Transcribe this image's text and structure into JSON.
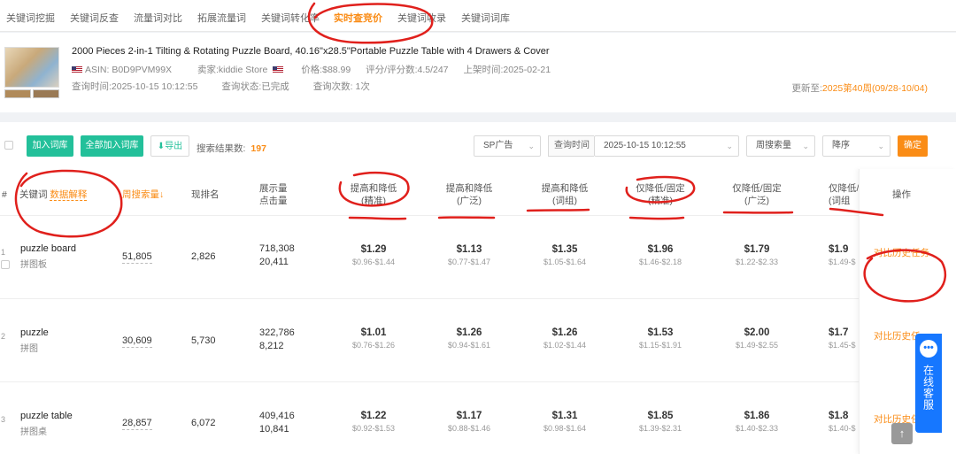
{
  "tabs": [
    "关键词挖掘",
    "关键词反查",
    "流量词对比",
    "拓展流量词",
    "关键词转化率",
    "实时查竞价",
    "关键词收录",
    "关键词词库"
  ],
  "product": {
    "title": "2000 Pieces 2-in-1 Tilting & Rotating Puzzle Board, 40.16\"x28.5\"Portable Puzzle Table with 4 Drawers & Cover",
    "asin": "ASIN: B0D9PVM99X",
    "seller": "卖家:kiddie Store",
    "price": "价格:$88.99",
    "rating": "评分/评分数:4.5/247",
    "listed": "上架时间:2025-02-21",
    "query_time": "查询时间:2025-10-15 10:12:55",
    "query_status": "查询状态:已完成",
    "query_count": "查询次数: 1次",
    "update_prefix": "更新至:",
    "update_value": "2025第40周(09/28-10/04)"
  },
  "toolbar": {
    "add_lib": "加入词库",
    "add_all_lib": "全部加入词库",
    "export": "导出",
    "result_label": "搜索结果数:",
    "result_count": "197",
    "ad_type": "SP广告",
    "query_time_label": "查询时间",
    "query_time_value": "2025-10-15 10:12:55",
    "metric": "周搜索量",
    "order": "降序",
    "confirm": "确定"
  },
  "columns": {
    "hash": "#",
    "keyword": "关键词",
    "keyword_help": "数据解释",
    "weekly": "周搜索量",
    "rank": "现排名",
    "impr": "展示量",
    "clicks": "点击量",
    "bid_cols": [
      {
        "top": "提高和降低",
        "sub": "(精准)"
      },
      {
        "top": "提高和降低",
        "sub": "(广泛)"
      },
      {
        "top": "提高和降低",
        "sub": "(词组)"
      },
      {
        "top": "仅降低/固定",
        "sub": "(精准)"
      },
      {
        "top": "仅降低/固定",
        "sub": "(广泛)"
      },
      {
        "top": "仅降低/",
        "sub": "(词组"
      }
    ],
    "ops": "操作"
  },
  "rows": [
    {
      "idx": "1",
      "kw": "puzzle board",
      "kw_cn": "拼图板",
      "weekly": "51,805",
      "rank": "2,826",
      "impr": "718,308",
      "clicks": "20,411",
      "bids": [
        [
          "$1.29",
          "$0.96-$1.44"
        ],
        [
          "$1.13",
          "$0.77-$1.47"
        ],
        [
          "$1.35",
          "$1.05-$1.64"
        ],
        [
          "$1.96",
          "$1.46-$2.18"
        ],
        [
          "$1.79",
          "$1.22-$2.33"
        ],
        [
          "$1.9",
          "$1.49-$"
        ]
      ],
      "op": "对比历史任务"
    },
    {
      "idx": "2",
      "kw": "puzzle",
      "kw_cn": "拼图",
      "weekly": "30,609",
      "rank": "5,730",
      "impr": "322,786",
      "clicks": "8,212",
      "bids": [
        [
          "$1.01",
          "$0.76-$1.26"
        ],
        [
          "$1.26",
          "$0.94-$1.61"
        ],
        [
          "$1.26",
          "$1.02-$1.44"
        ],
        [
          "$1.53",
          "$1.15-$1.91"
        ],
        [
          "$2.00",
          "$1.49-$2.55"
        ],
        [
          "$1.7",
          "$1.45-$"
        ]
      ],
      "op": "对比历史任"
    },
    {
      "idx": "3",
      "kw": "puzzle table",
      "kw_cn": "拼图桌",
      "weekly": "28,857",
      "rank": "6,072",
      "impr": "409,416",
      "clicks": "10,841",
      "bids": [
        [
          "$1.22",
          "$0.92-$1.53"
        ],
        [
          "$1.17",
          "$0.88-$1.46"
        ],
        [
          "$1.31",
          "$0.98-$1.64"
        ],
        [
          "$1.85",
          "$1.39-$2.31"
        ],
        [
          "$1.86",
          "$1.40-$2.33"
        ],
        [
          "$1.8",
          "$1.40-$"
        ]
      ],
      "op": "对比历史任"
    }
  ],
  "service": {
    "text": "在线客服"
  },
  "colors": {
    "accent": "#fa8c16",
    "green": "#23c09a",
    "service_blue": "#1677ff",
    "ink_red": "#e0201c"
  }
}
